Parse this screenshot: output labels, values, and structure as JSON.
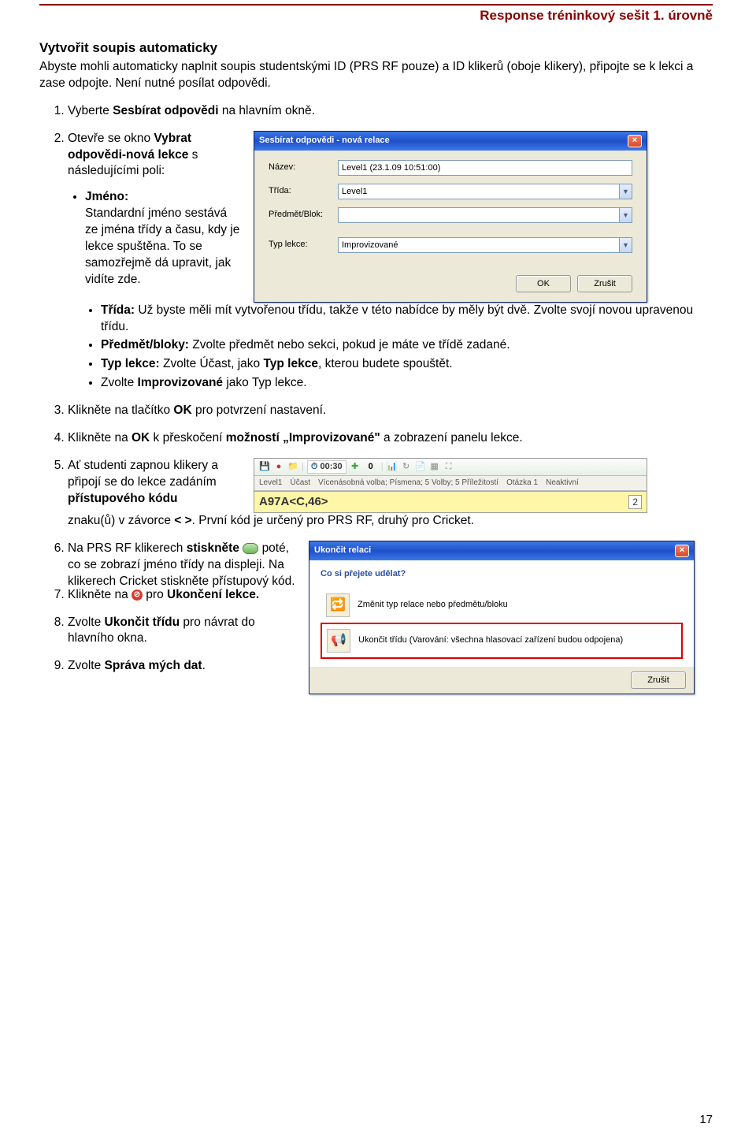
{
  "header": {
    "title": "Response tréninkový sešit 1. úrovně"
  },
  "section": {
    "title": "Vytvořit soupis automaticky",
    "intro": "Abyste mohli automaticky naplnit soupis studentskými ID (PRS RF pouze) a ID klikerů (oboje klikery), připojte se k lekci a zase odpojte. Není nutné posílat odpovědi."
  },
  "steps": {
    "s1_pre": "Vyberte ",
    "s1_bold": "Sesbírat odpovědi",
    "s1_post": " na hlavním okně.",
    "s2a": "Otevře se okno ",
    "s2a_bold": "Vybrat odpovědi-nová lekce",
    "s2a_post": " s následujícími poli:",
    "jmeno_label": "Jméno:",
    "jmeno_text": "Standardní jméno sestává ze jména třídy a času, kdy je lekce spuštěna. To se samozřejmě dá upravit, jak vidíte zde.",
    "trida_label": "Třída:",
    "trida_text": " Už byste měli mít vytvořenou třídu, takže v této nabídce by měly být dvě. Zvolte svojí novou upravenou třídu.",
    "predmet_label": "Předmět/bloky:",
    "predmet_text": " Zvolte předmět nebo sekci, pokud je máte ve třídě zadané.",
    "typ_label": "Typ lekce:",
    "typ_text_a": " Zvolte Účast, jako ",
    "typ_text_b": "Typ lekce",
    "typ_text_c": ", kterou budete spouštět.",
    "improv_a": "Zvolte ",
    "improv_b": "Improvizované",
    "improv_c": " jako Typ lekce.",
    "s2b_a": "Klikněte na tlačítko ",
    "s2b_b": "OK",
    "s2b_c": " pro potvrzení nastavení.",
    "s3a": "Klikněte na ",
    "s3b": "OK",
    "s3c": " k přeskočení ",
    "s3d": "možností „Improvizované\"",
    "s3e": " a zobrazení panelu lekce.",
    "s4a": "Ať studenti zapnou klikery a připojí se do lekce zadáním ",
    "s4b": "přístupového kódu",
    "s4c": " znaku(ů) v závorce ",
    "s4d": "< >",
    "s4e": ". První kód je určený pro PRS RF, druhý pro Cricket.",
    "s5a": "Na PRS RF klikerech ",
    "s5b": "stiskněte",
    "s5c": " poté, co se zobrazí jméno třídy na displeji. Na klikerech Cricket stiskněte přístupový kód.",
    "s6a": "Klikněte na ",
    "s6b": " pro ",
    "s6c": "Ukončení lekce.",
    "s7a": "Zvolte ",
    "s7b": "Ukončit třídu",
    "s7c": " pro návrat do hlavního okna.",
    "s8a": "Zvolte ",
    "s8b": "Správa mých dat",
    "s8c": "."
  },
  "dialog1": {
    "title": "Sesbírat odpovědi - nová relace",
    "label_nazev": "Název:",
    "val_nazev": "Level1 (23.1.09 10:51:00)",
    "label_trida": "Třída:",
    "val_trida": "Level1",
    "label_predmet": "Předmět/Blok:",
    "val_predmet": "",
    "label_typ": "Typ lekce:",
    "val_typ": "Improvizované",
    "ok": "OK",
    "cancel": "Zrušit"
  },
  "toolbar": {
    "timer": "00:30",
    "count": "0",
    "line2_1": "Level1",
    "line2_2": "Účast",
    "line2_3": "Vícenásobná volba; Písmena; 5 Volby; 5 Příležitostí",
    "line2_4": "Otázka 1",
    "line2_5": "Neaktivní",
    "code": "A97A<C,46>",
    "rightnum": "2"
  },
  "dialog2": {
    "title": "Ukončit relaci",
    "question": "Co si přejete udělat?",
    "opt1": "Změnit typ relace nebo předmětu/bloku",
    "opt2a": "Ukončit třídu (V",
    "opt2b": "arování: všechna hlasovací zařízení budou odpojena)",
    "cancel": "Zrušit"
  },
  "page_num": "17"
}
